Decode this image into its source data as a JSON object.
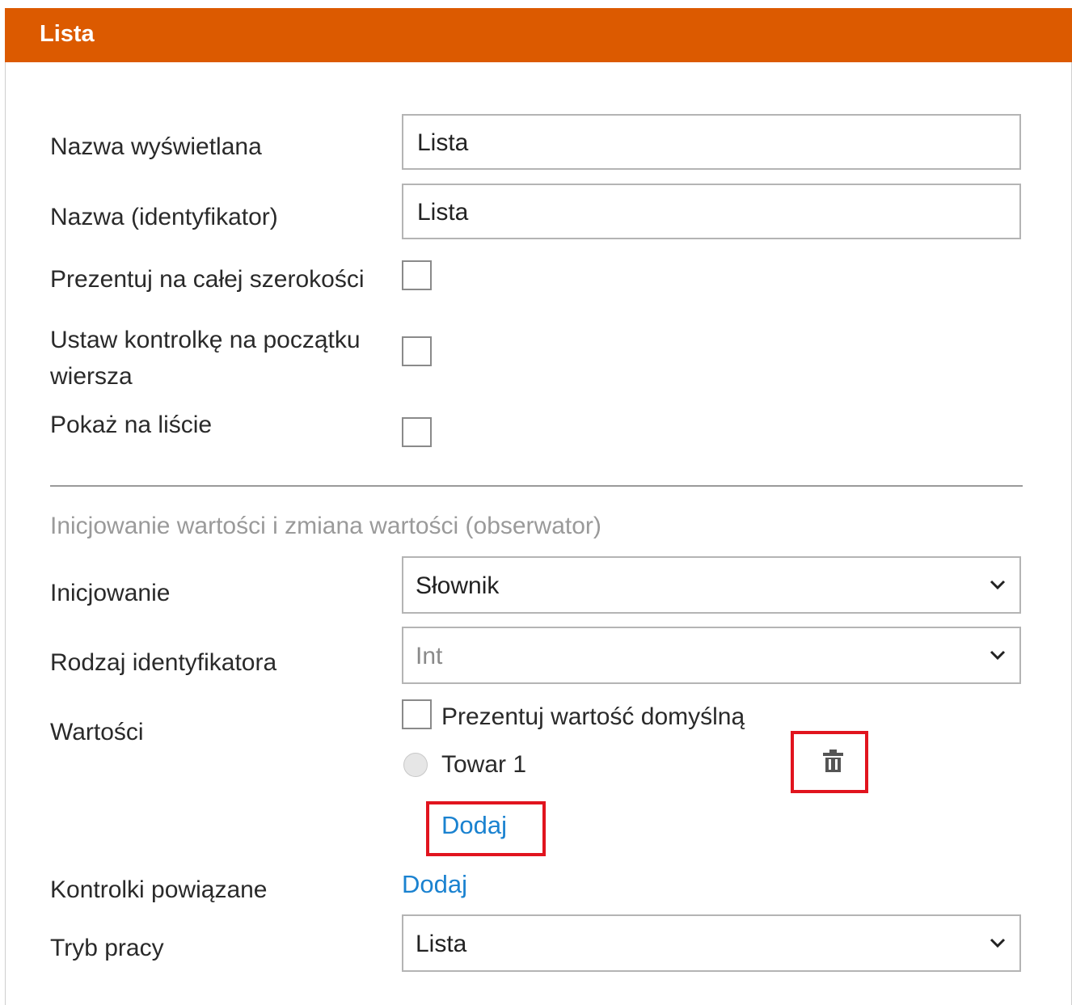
{
  "panel": {
    "title": "Lista",
    "header_color": "#dc5a00"
  },
  "fields": {
    "display_name": {
      "label": "Nazwa wyświetlana",
      "value": "Lista"
    },
    "identifier": {
      "label": "Nazwa (identyfikator)",
      "value": "Lista"
    },
    "full_width": {
      "label": "Prezentuj na całej szerokości",
      "checked": false
    },
    "control_at_row_start": {
      "label": "Ustaw kontrolkę na początku wiersza",
      "checked": false
    },
    "show_on_list": {
      "label": "Pokaż na liście",
      "checked": false
    }
  },
  "section": {
    "title": "Inicjowanie wartości i zmiana wartości (obserwator)"
  },
  "initialization": {
    "label": "Inicjowanie",
    "selected": "Słownik"
  },
  "identifier_type": {
    "label": "Rodzaj identyfikatora",
    "selected": "Int"
  },
  "values": {
    "label": "Wartości",
    "show_default_label": "Prezentuj wartość domyślną",
    "show_default_checked": false,
    "items": [
      {
        "label": "Towar 1",
        "icon": "trash-icon"
      }
    ],
    "add_label": "Dodaj"
  },
  "related_controls": {
    "label": "Kontrolki powiązane",
    "add_label": "Dodaj"
  },
  "work_mode": {
    "label": "Tryb pracy",
    "selected": "Lista"
  },
  "colors": {
    "link": "#1a82d0",
    "highlight": "#e1141e"
  }
}
